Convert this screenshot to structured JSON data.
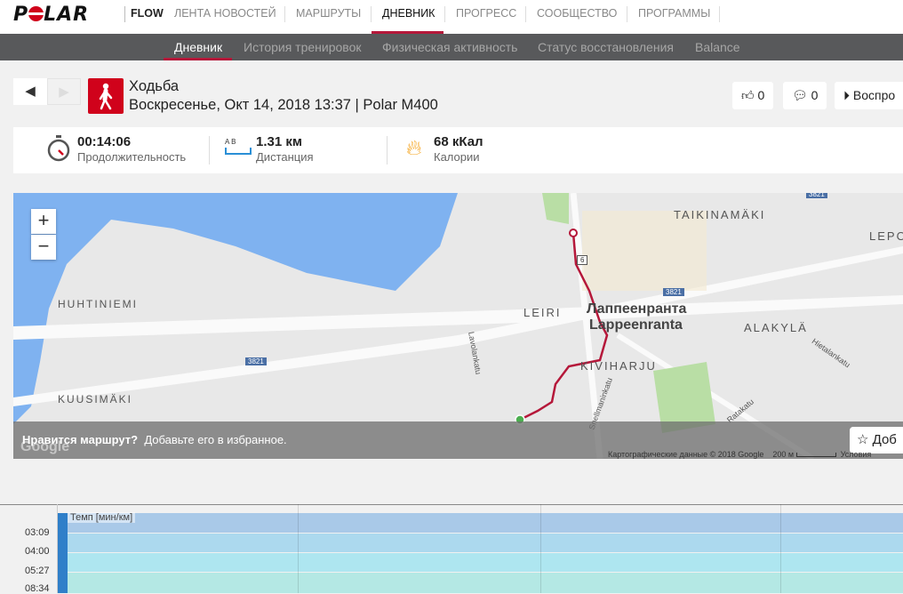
{
  "nav": {
    "logo": "POLAR",
    "flow": "FLOW",
    "items": [
      "ЛЕНТА НОВОСТЕЙ",
      "МАРШРУТЫ",
      "ДНЕВНИК",
      "ПРОГРЕСС",
      "СООБЩЕСТВО",
      "ПРОГРАММЫ"
    ]
  },
  "subnav": [
    "Дневник",
    "История тренировок",
    "Физическая активность",
    "Статус восстановления",
    "Balance"
  ],
  "session": {
    "title": "Ходьба",
    "subtitle": "Воскресенье, Окт 14, 2018 13:37 | Polar M400",
    "likes": "0",
    "comments": "0",
    "play": "Воспро"
  },
  "stats": [
    {
      "value": "00:14:06",
      "label": "Продолжительность"
    },
    {
      "value": "1.31 км",
      "label": "Дистанция",
      "icon_text": "A B"
    },
    {
      "value": "68 кКал",
      "label": "Калории"
    }
  ],
  "map": {
    "labels": [
      "TAIKINAMÄKI",
      "LEPO",
      "HUHTINIEMI",
      "LEIRI",
      "Лаппеенранта",
      "Lappeenranta",
      "ALAKYLÄ",
      "KIVIHARJU",
      "KUUSIMÄKI",
      "Lavolankatu",
      "Hietalankatu",
      "Ratakatu",
      "Snellmaninkatu"
    ],
    "road_badges": [
      "3821",
      "3821",
      "3821",
      "6"
    ],
    "zoom_in": "+",
    "zoom_out": "−",
    "banner_bold": "Нравится маршрут?",
    "banner_text": "Добавьте его в избранное.",
    "fav_button": "Доб",
    "attribution": "Картографические данные © 2018 Google",
    "scale": "200 м",
    "terms": "Условия",
    "google": "Google"
  },
  "chart": {
    "legend": "Темп [мин/км]",
    "yticks": [
      "03:09",
      "04:00",
      "05:27",
      "08:34"
    ]
  },
  "colors": {
    "accent": "#b5183a",
    "zone1": "#a9c9e8",
    "zone2": "#acd9ee",
    "zone3": "#aee6f0",
    "zone4": "#b4e8e4"
  }
}
